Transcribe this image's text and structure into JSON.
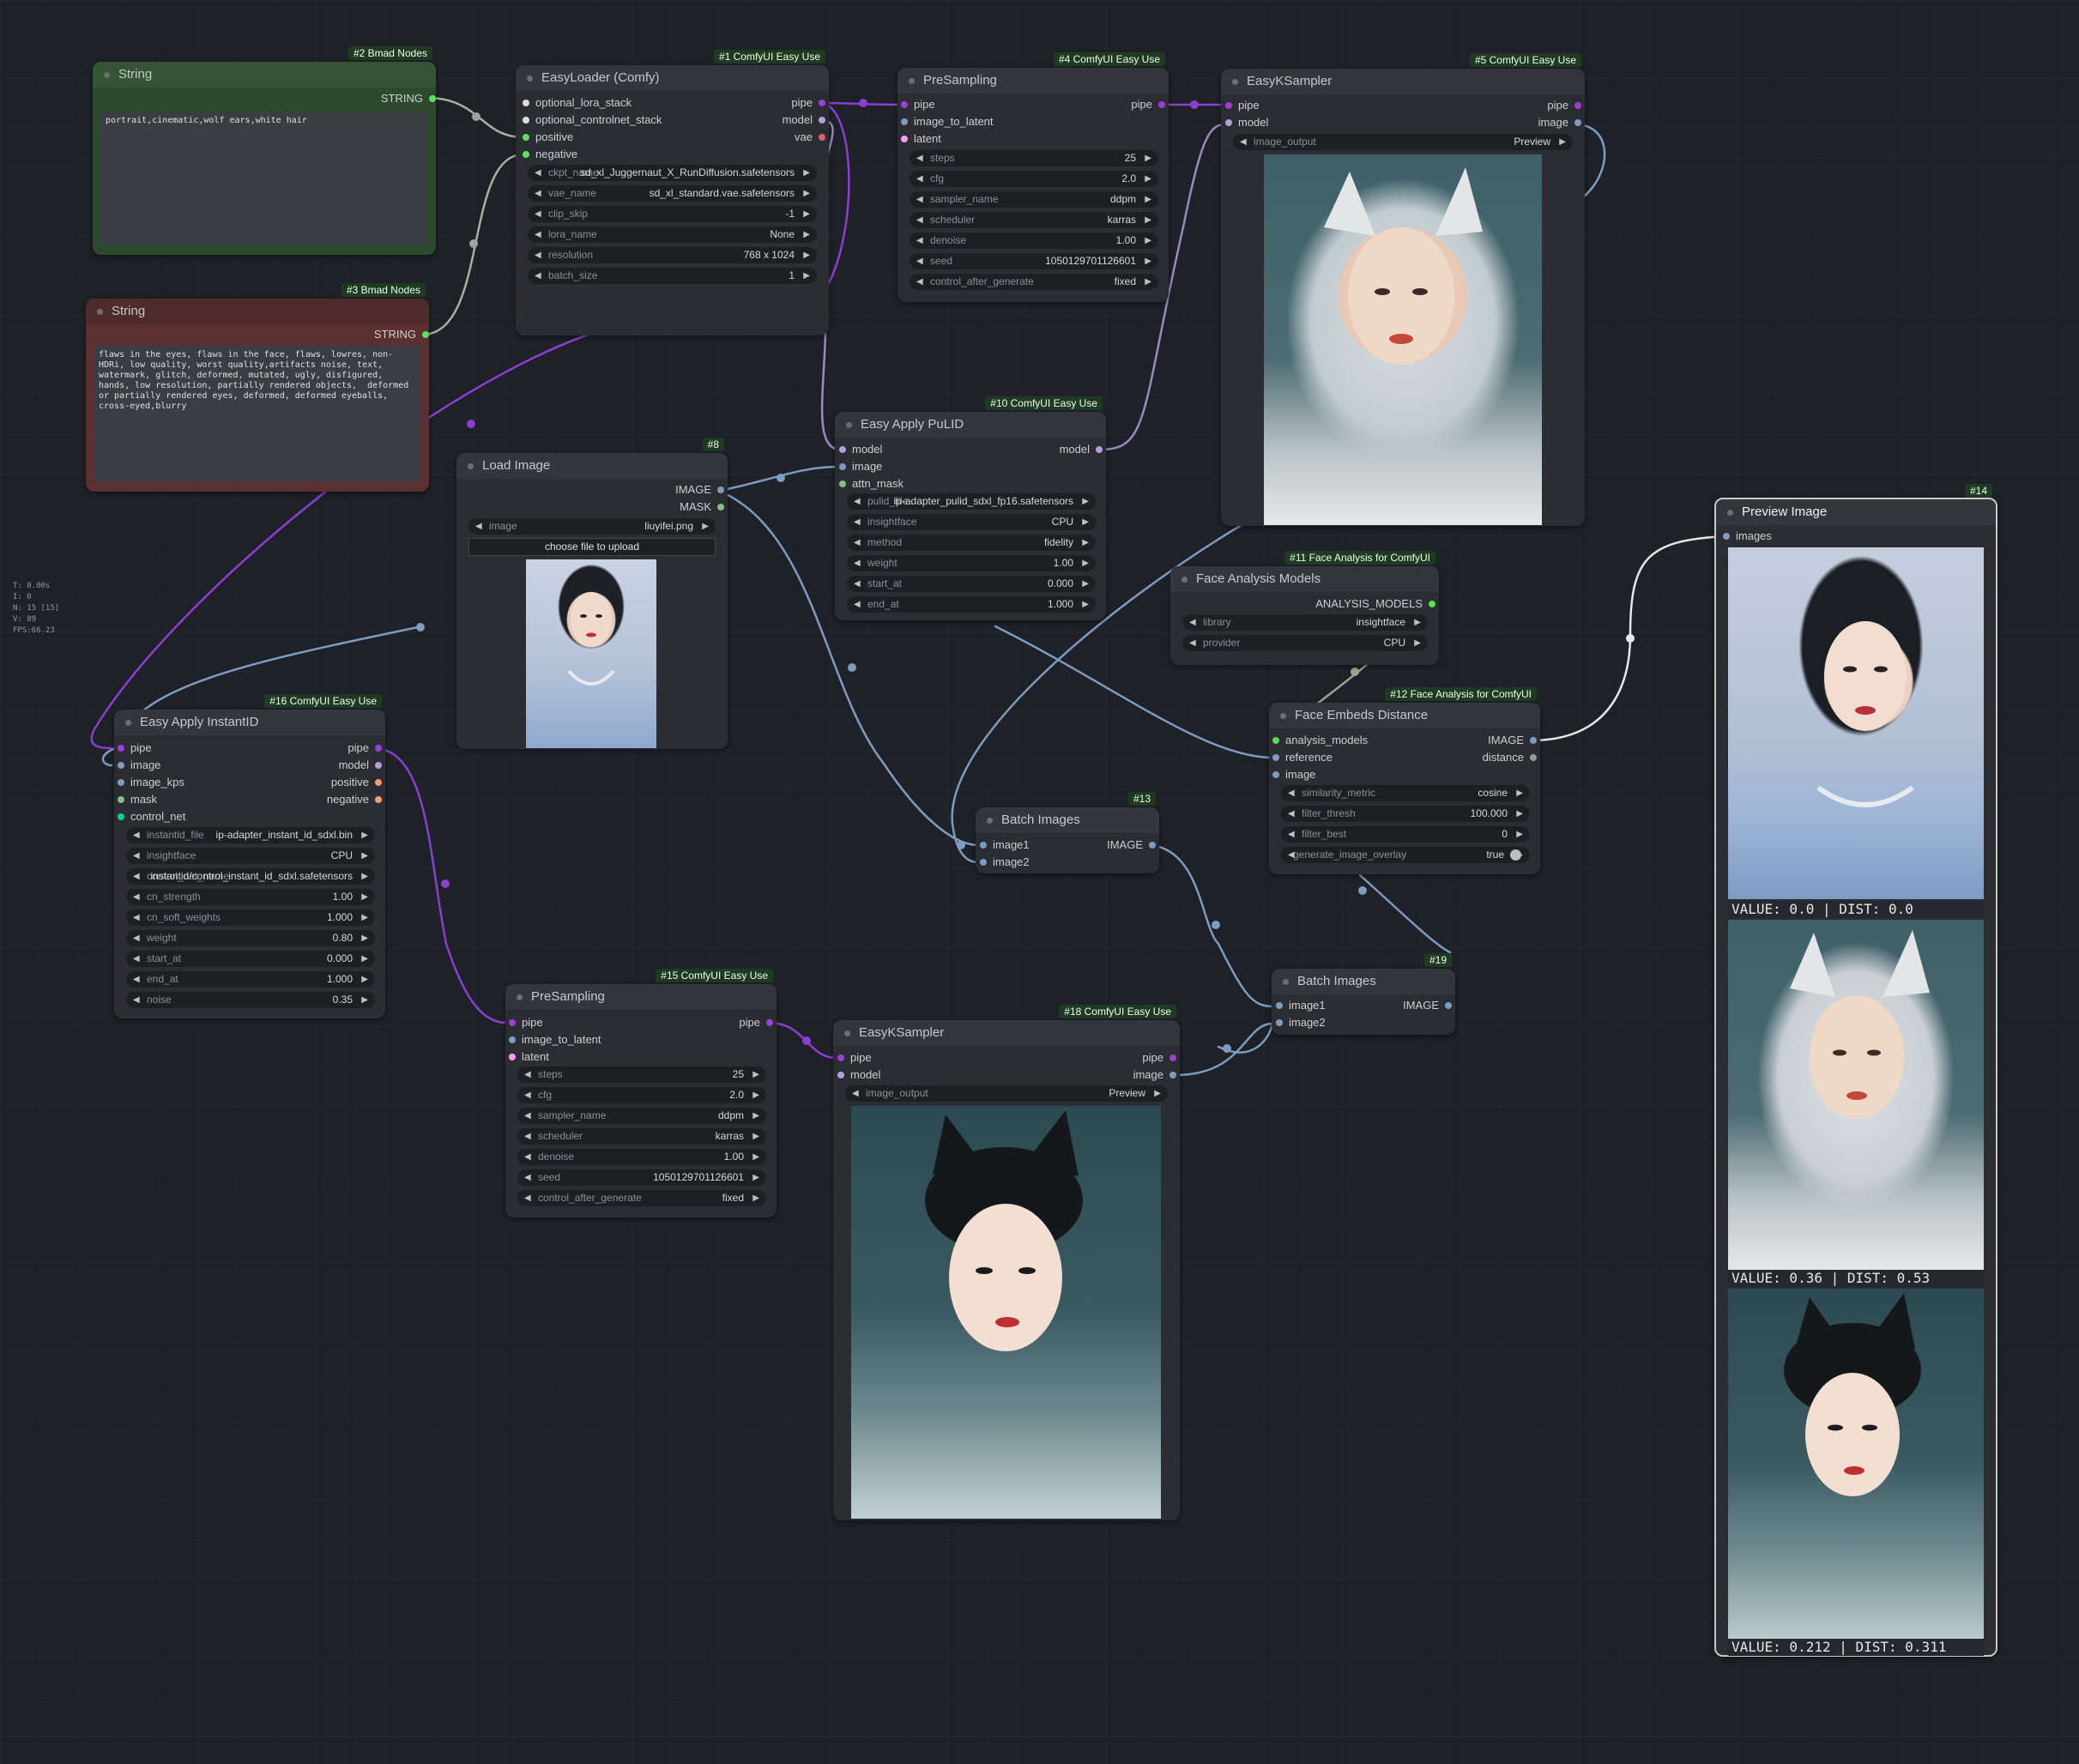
{
  "stats": [
    "T: 0.00s",
    "I: 0",
    "N: 15 [15]",
    "V: 89",
    "FPS:66.23"
  ],
  "colors": {
    "pipe": "#9b3fd6",
    "image": "#7e9bc0",
    "model": "#b39ddb",
    "positive": "#f0a070",
    "negative": "#e06060",
    "string": "#5de05d",
    "latent": "#ff9cf9",
    "mask": "#80c080",
    "control": "#00d78d",
    "analysis": "#50e050"
  },
  "n2": {
    "badge": "#2 Bmad Nodes",
    "title": "String",
    "out": "STRING",
    "text": "portrait,cinematic,wolf ears,white hair"
  },
  "n3": {
    "badge": "#3 Bmad Nodes",
    "title": "String",
    "out": "STRING",
    "text": "flaws in the eyes, flaws in the face, flaws, lowres, non-HDRi, low quality, worst quality,artifacts noise, text, watermark, glitch, deformed, mutated, ugly, disfigured, hands, low resolution, partially rendered objects,  deformed or partially rendered eyes, deformed, deformed eyeballs, cross-eyed,blurry"
  },
  "n1": {
    "badge": "#1 ComfyUI Easy Use",
    "title": "EasyLoader (Comfy)",
    "inputs": [
      "optional_lora_stack",
      "optional_controlnet_stack",
      "positive",
      "negative"
    ],
    "outputs": [
      "pipe",
      "model",
      "vae"
    ],
    "widgets": [
      {
        "l": "ckpt_name",
        "v": "sd_xl_Juggernaut_X_RunDiffusion.safetensors"
      },
      {
        "l": "vae_name",
        "v": "sd_xl_standard.vae.safetensors"
      },
      {
        "l": "clip_skip",
        "v": "-1"
      },
      {
        "l": "lora_name",
        "v": "None"
      },
      {
        "l": "resolution",
        "v": "768 x 1024"
      },
      {
        "l": "batch_size",
        "v": "1"
      }
    ]
  },
  "n4": {
    "badge": "#4 ComfyUI Easy Use",
    "title": "PreSampling",
    "inputs": [
      "pipe",
      "image_to_latent",
      "latent"
    ],
    "outputs": [
      "pipe"
    ],
    "widgets": [
      {
        "l": "steps",
        "v": "25"
      },
      {
        "l": "cfg",
        "v": "2.0"
      },
      {
        "l": "sampler_name",
        "v": "ddpm"
      },
      {
        "l": "scheduler",
        "v": "karras"
      },
      {
        "l": "denoise",
        "v": "1.00"
      },
      {
        "l": "seed",
        "v": "1050129701126601"
      },
      {
        "l": "control_after_generate",
        "v": "fixed"
      }
    ]
  },
  "n5": {
    "badge": "#5 ComfyUI Easy Use",
    "title": "EasyKSampler",
    "inputs": [
      "pipe",
      "model"
    ],
    "outputs": [
      "pipe",
      "image"
    ],
    "widget": {
      "l": "image_output",
      "v": "Preview"
    }
  },
  "n10": {
    "badge": "#10 ComfyUI Easy Use",
    "title": "Easy Apply PuLID",
    "inputs": [
      "model",
      "image",
      "attn_mask"
    ],
    "outputs": [
      "model"
    ],
    "widgets": [
      {
        "l": "pulid_file",
        "v": "ip-adapter_pulid_sdxl_fp16.safetensors"
      },
      {
        "l": "insightface",
        "v": "CPU"
      },
      {
        "l": "method",
        "v": "fidelity"
      },
      {
        "l": "weight",
        "v": "1.00"
      },
      {
        "l": "start_at",
        "v": "0.000"
      },
      {
        "l": "end_at",
        "v": "1.000"
      }
    ]
  },
  "n8": {
    "badge": "#8",
    "title": "Load Image",
    "outputs": [
      "IMAGE",
      "MASK"
    ],
    "widget": {
      "l": "image",
      "v": "liuyifei.png"
    },
    "upload": "choose file to upload"
  },
  "n11": {
    "badge": "#11 Face Analysis for ComfyUI",
    "title": "Face Analysis Models",
    "outputs": [
      "ANALYSIS_MODELS"
    ],
    "widgets": [
      {
        "l": "library",
        "v": "insightface"
      },
      {
        "l": "provider",
        "v": "CPU"
      }
    ]
  },
  "n12": {
    "badge": "#12 Face Analysis for ComfyUI",
    "title": "Face Embeds Distance",
    "inputs": [
      "analysis_models",
      "reference",
      "image"
    ],
    "outputs": [
      "IMAGE",
      "distance"
    ],
    "widgets": [
      {
        "l": "similarity_metric",
        "v": "cosine"
      },
      {
        "l": "filter_thresh",
        "v": "100.000"
      },
      {
        "l": "filter_best",
        "v": "0"
      }
    ],
    "toggle": {
      "l": "generate_image_overlay",
      "v": "true"
    }
  },
  "n13": {
    "badge": "#13",
    "title": "Batch Images",
    "inputs": [
      "image1",
      "image2"
    ],
    "outputs": [
      "IMAGE"
    ]
  },
  "n19": {
    "badge": "#19",
    "title": "Batch Images",
    "inputs": [
      "image1",
      "image2"
    ],
    "outputs": [
      "IMAGE"
    ]
  },
  "n14": {
    "badge": "#14",
    "title": "Preview Image",
    "inputs": [
      "images"
    ],
    "captions": [
      "VALUE: 0.0 | DIST: 0.0",
      "VALUE: 0.36 | DIST: 0.53",
      "VALUE: 0.212 | DIST: 0.311"
    ]
  },
  "n16": {
    "badge": "#16 ComfyUI Easy Use",
    "title": "Easy Apply InstantID",
    "inputs": [
      "pipe",
      "image",
      "image_kps",
      "mask",
      "control_net"
    ],
    "outputs": [
      "pipe",
      "model",
      "positive",
      "negative"
    ],
    "widgets": [
      {
        "l": "instantid_file",
        "v": "ip-adapter_instant_id_sdxl.bin"
      },
      {
        "l": "insightface",
        "v": "CPU"
      },
      {
        "l": "control_net_name",
        "v": "instantid/control_instant_id_sdxl.safetensors"
      },
      {
        "l": "cn_strength",
        "v": "1.00"
      },
      {
        "l": "cn_soft_weights",
        "v": "1.000"
      },
      {
        "l": "weight",
        "v": "0.80"
      },
      {
        "l": "start_at",
        "v": "0.000"
      },
      {
        "l": "end_at",
        "v": "1.000"
      },
      {
        "l": "noise",
        "v": "0.35"
      }
    ]
  },
  "n15": {
    "badge": "#15 ComfyUI Easy Use",
    "title": "PreSampling",
    "inputs": [
      "pipe",
      "image_to_latent",
      "latent"
    ],
    "outputs": [
      "pipe"
    ],
    "widgets": [
      {
        "l": "steps",
        "v": "25"
      },
      {
        "l": "cfg",
        "v": "2.0"
      },
      {
        "l": "sampler_name",
        "v": "ddpm"
      },
      {
        "l": "scheduler",
        "v": "karras"
      },
      {
        "l": "denoise",
        "v": "1.00"
      },
      {
        "l": "seed",
        "v": "1050129701126601"
      },
      {
        "l": "control_after_generate",
        "v": "fixed"
      }
    ]
  },
  "n18": {
    "badge": "#18 ComfyUI Easy Use",
    "title": "EasyKSampler",
    "inputs": [
      "pipe",
      "model"
    ],
    "outputs": [
      "pipe",
      "image"
    ],
    "widget": {
      "l": "image_output",
      "v": "Preview"
    }
  }
}
